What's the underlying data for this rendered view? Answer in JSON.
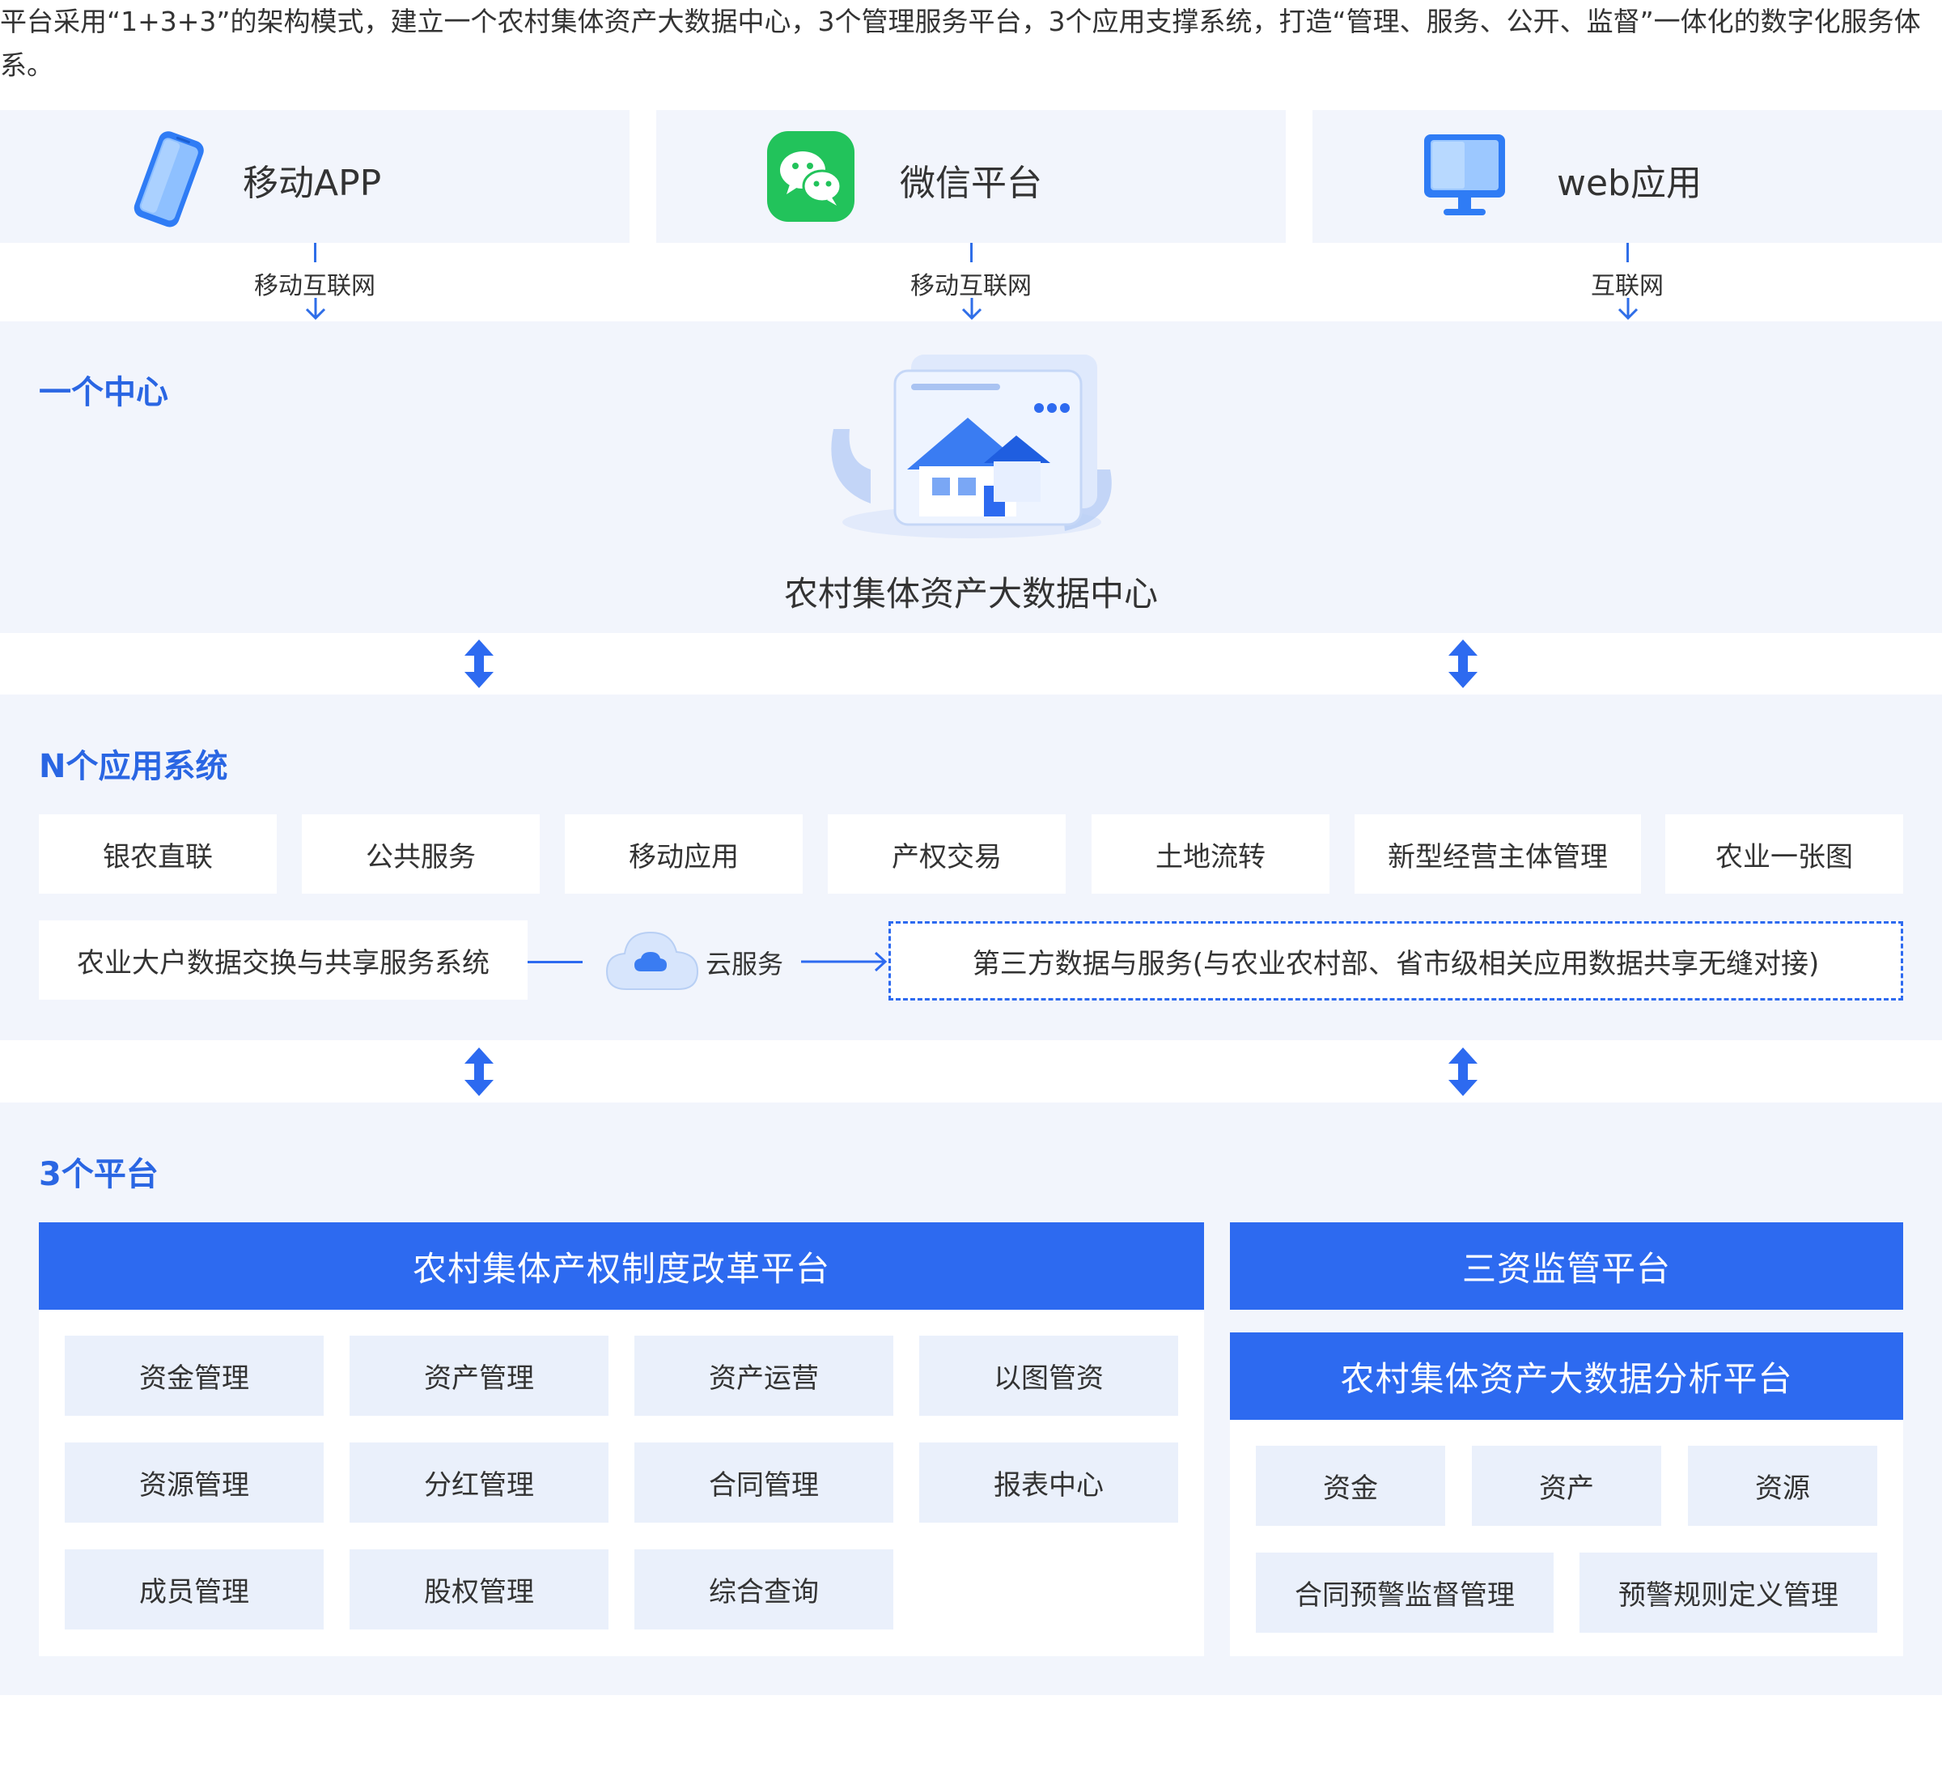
{
  "intro": "平台采用“1+3+3”的架构模式，建立一个农村集体资产大数据中心，3个管理服务平台，3个应用支撑系统，打造“管理、服务、公开、监督”一体化的数字化服务体系。",
  "clients": [
    {
      "label": "移动APP",
      "icon": "mobile-phone-icon",
      "connection": "移动互联网"
    },
    {
      "label": "微信平台",
      "icon": "wechat-icon",
      "connection": "移动互联网"
    },
    {
      "label": "web应用",
      "icon": "monitor-icon",
      "connection": "互联网"
    }
  ],
  "center": {
    "section_title": "一个中心",
    "name": "农村集体资产大数据中心",
    "icon": "data-center-house-icon"
  },
  "apps": {
    "section_title": "N个应用系统",
    "items": [
      "银农直联",
      "公共服务",
      "移动应用",
      "产权交易",
      "土地流转",
      "新型经营主体管理",
      "农业一张图"
    ],
    "exchange": "农业大户数据交换与共享服务系统",
    "cloud": "云服务",
    "third_party": "第三方数据与服务(与农业农村部、省市级相关应用数据共享无缝对接)"
  },
  "platforms": {
    "section_title": "3个平台",
    "reform": {
      "title": "农村集体产权制度改革平台",
      "modules": [
        "资金管理",
        "资产管理",
        "资产运营",
        "以图管资",
        "资源管理",
        "分红管理",
        "合同管理",
        "报表中心",
        "成员管理",
        "股权管理",
        "综合查询"
      ]
    },
    "supervision": {
      "title": "三资监管平台"
    },
    "analysis": {
      "title": "农村集体资产大数据分析平台",
      "modules_top": [
        "资金",
        "资产",
        "资源"
      ],
      "modules_bottom": [
        "合同预警监督管理",
        "预警规则定义管理"
      ]
    }
  },
  "colors": {
    "accent": "#2d6af0",
    "section_title": "#2a66e3",
    "band": "#f2f5fc",
    "module": "#eaf0fb"
  }
}
